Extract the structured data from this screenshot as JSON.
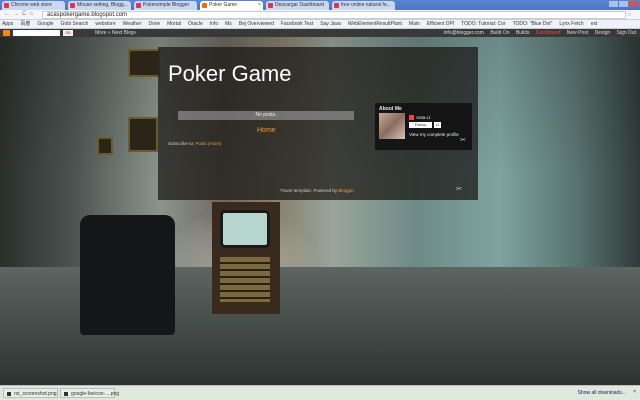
{
  "browser": {
    "tabs": [
      {
        "label": "Chrome web store"
      },
      {
        "label": "Mouse setting, Blogg..."
      },
      {
        "label": "Pokersimple Blogger"
      },
      {
        "label": "Poker Game",
        "active": true
      },
      {
        "label": "Descargar Dashboard"
      },
      {
        "label": "free online natural fo..."
      }
    ],
    "url": "acaspokergame.blogspot.com",
    "bookmarks": [
      "Apps",
      "百度",
      "Google",
      "Gobi Search",
      "webstore",
      "Weather",
      "Drive",
      "Mortal",
      "Oracle",
      "Info",
      "Ms",
      "Bej Overviewed",
      "Facebook Test",
      "Say Java",
      "WebElementResultPlant",
      "Main",
      "Efficient DPI",
      "TODO: Tutorial: Cor",
      "TODO: \"Blue Dot\"",
      "Lynx Fetch",
      "ext"
    ]
  },
  "navbar": {
    "search_button": "SB",
    "more": "More »",
    "next_blog": "Next Blog»",
    "right": [
      "info@blogger.com",
      "Build On",
      "Builds",
      "Dashboard",
      "New Post",
      "Design",
      "Sign Out"
    ]
  },
  "blog": {
    "title": "Poker Game",
    "no_posts": "No posts.",
    "home": "Home",
    "subscribe_prefix": "Subscribe to: ",
    "subscribe_link": "Posts (Atom)",
    "about": {
      "heading": "About Me",
      "name": "Anta LI",
      "follow": "Follow",
      "count": "11",
      "view_profile": "View my complete profile"
    },
    "footer_prefix": "Travel template. Powered by ",
    "footer_link": "Blogger."
  },
  "downloads": {
    "items": [
      "rst_screenshot.png",
      "google-favicon-....png"
    ],
    "show_all": "Show all downloads...",
    "close": "×"
  }
}
